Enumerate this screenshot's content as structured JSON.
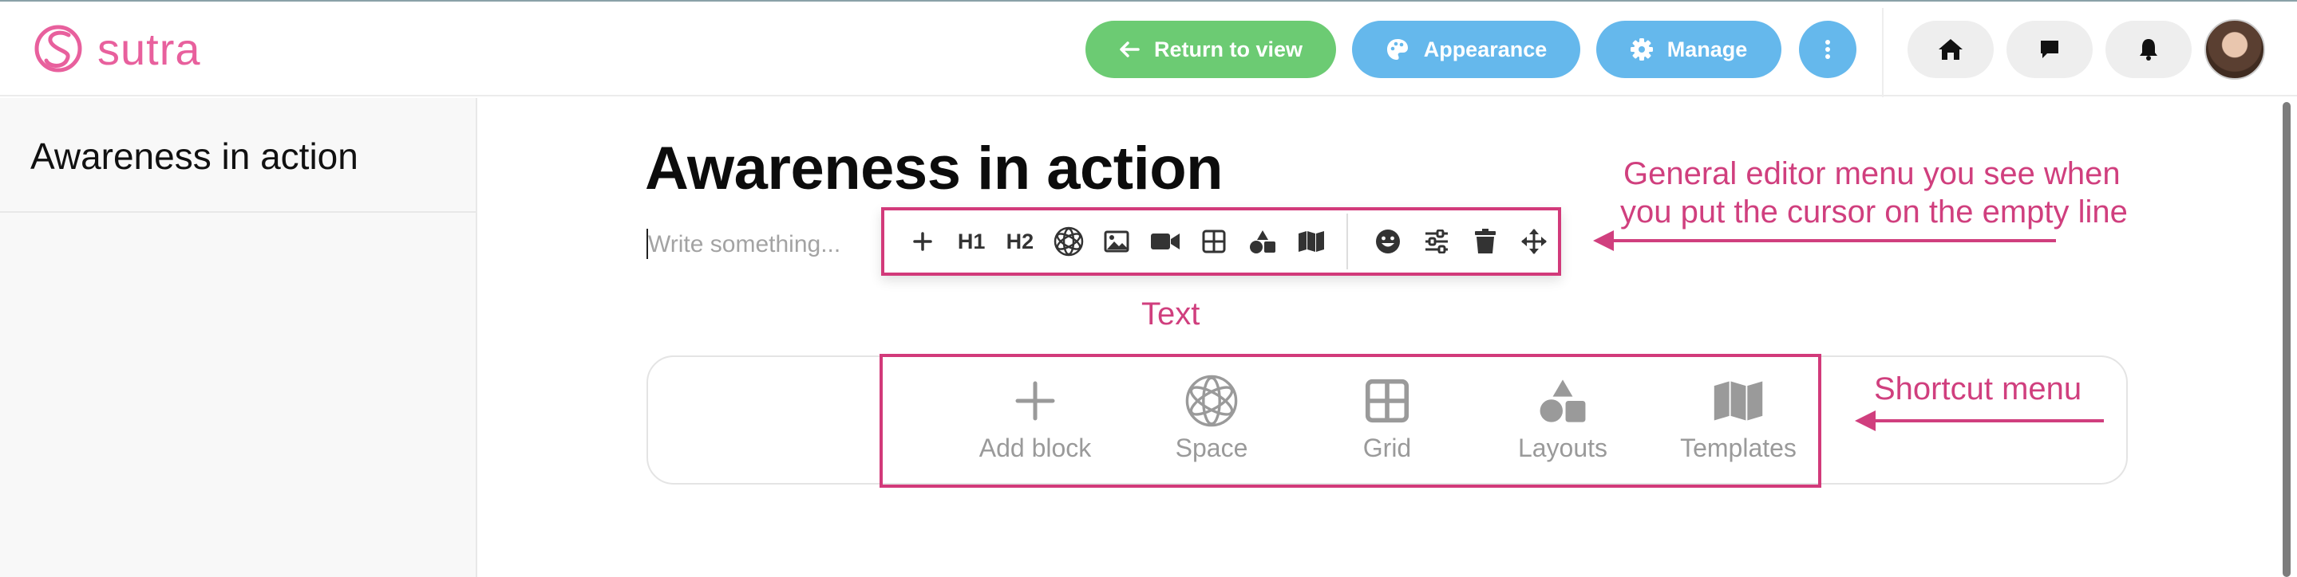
{
  "app": {
    "logo_text": "sutra"
  },
  "header": {
    "return_label": "Return to view",
    "appearance_label": "Appearance",
    "manage_label": "Manage",
    "more_icon": "more-vertical-icon",
    "home_icon": "home-icon",
    "chat_icon": "chat-icon",
    "bell_icon": "bell-icon"
  },
  "sidebar": {
    "items": [
      {
        "label": "Awareness in action"
      }
    ]
  },
  "page": {
    "title": "Awareness in action",
    "placeholder": "Write something..."
  },
  "editor_menu": {
    "items": [
      {
        "icon": "plus-icon"
      },
      {
        "label": "H1"
      },
      {
        "label": "H2"
      },
      {
        "icon": "space-icon"
      },
      {
        "icon": "image-icon"
      },
      {
        "icon": "video-icon"
      },
      {
        "icon": "grid-icon"
      },
      {
        "icon": "layouts-icon"
      },
      {
        "icon": "templates-icon"
      },
      {
        "icon": "emoji-icon"
      },
      {
        "icon": "sliders-icon"
      },
      {
        "icon": "trash-icon"
      },
      {
        "icon": "move-icon"
      }
    ]
  },
  "shortcut_menu": {
    "items": [
      {
        "label": "Add block",
        "icon": "plus-icon"
      },
      {
        "label": "Space",
        "icon": "space-icon"
      },
      {
        "label": "Grid",
        "icon": "grid-icon"
      },
      {
        "label": "Layouts",
        "icon": "layouts-icon"
      },
      {
        "label": "Templates",
        "icon": "templates-icon"
      }
    ]
  },
  "annotations": {
    "editor_menu_line1": "General editor menu you see when",
    "editor_menu_line2": "you put the cursor on the empty line",
    "text_label": "Text",
    "shortcut_label": "Shortcut menu",
    "color": "#d03f7e"
  },
  "colors": {
    "brand": "#e8609d",
    "return_green": "#6ccb73",
    "action_blue": "#65b8ec"
  }
}
